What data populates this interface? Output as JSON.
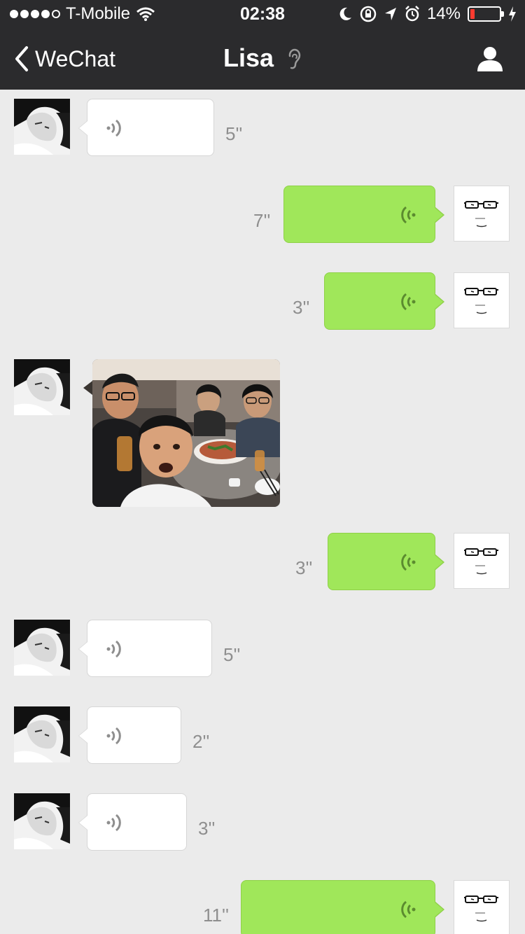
{
  "status_bar": {
    "carrier": "T-Mobile",
    "time": "02:38",
    "battery": "14%",
    "battery_level": 0.14
  },
  "nav": {
    "back_label": "WeChat",
    "title": "Lisa"
  },
  "messages": [
    {
      "sender": "Lisa",
      "type": "voice",
      "duration": "5''"
    },
    {
      "sender": "me",
      "type": "voice",
      "duration": "7''"
    },
    {
      "sender": "me",
      "type": "voice",
      "duration": "3''"
    },
    {
      "sender": "Lisa",
      "type": "image"
    },
    {
      "sender": "me",
      "type": "voice",
      "duration": "3''"
    },
    {
      "sender": "Lisa",
      "type": "voice",
      "duration": "5''"
    },
    {
      "sender": "Lisa",
      "type": "voice",
      "duration": "2''"
    },
    {
      "sender": "Lisa",
      "type": "voice",
      "duration": "3''"
    },
    {
      "sender": "me",
      "type": "voice",
      "duration": "11''"
    }
  ],
  "colors": {
    "nav_bg": "#2b2b2d",
    "chat_bg": "#ebebeb",
    "outgoing_bubble": "#a0e75a",
    "incoming_bubble": "#ffffff",
    "battery_low": "#ff3b30"
  },
  "icons": [
    "back-chevron-icon",
    "ear-icon",
    "profile-icon",
    "wifi-icon",
    "moon-icon",
    "rotation-lock-icon",
    "location-arrow-icon",
    "alarm-icon",
    "charging-bolt-icon",
    "voice-wave-icon"
  ]
}
